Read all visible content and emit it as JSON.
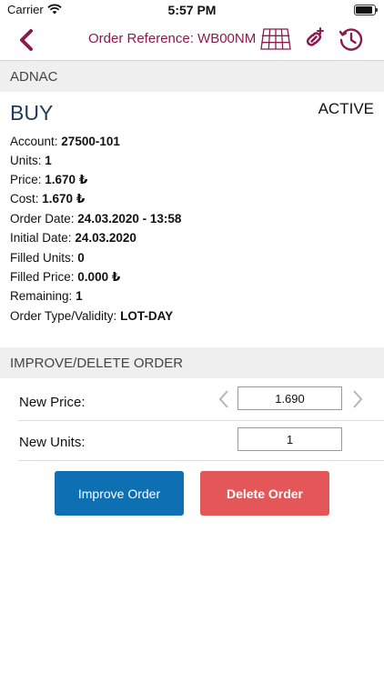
{
  "status_bar": {
    "carrier": "Carrier",
    "time": "5:57 PM"
  },
  "nav": {
    "title": "Order Reference: WB00NM"
  },
  "instrument": {
    "name": "ADNAC"
  },
  "order": {
    "side": "BUY",
    "status": "ACTIVE",
    "details": [
      {
        "label": "Account:",
        "value": "27500-101"
      },
      {
        "label": "Units:",
        "value": "1"
      },
      {
        "label": "Price:",
        "value": "1.670 ₺"
      },
      {
        "label": "Cost:",
        "value": "1.670 ₺"
      },
      {
        "label": "Order Date:",
        "value": "24.03.2020 - 13:58"
      },
      {
        "label": "Initial Date:",
        "value": "24.03.2020"
      },
      {
        "label": "Filled Units:",
        "value": "0"
      },
      {
        "label": "Filled Price:",
        "value": "0.000 ₺"
      },
      {
        "label": "Remaining:",
        "value": "1"
      },
      {
        "label": "Order Type/Validity:",
        "value": "LOT-DAY"
      }
    ]
  },
  "improve_section": {
    "header": "IMPROVE/DELETE ORDER",
    "new_price_label": "New Price:",
    "new_price_value": "1.690",
    "new_units_label": "New Units:",
    "new_units_value": "1",
    "improve_button": "Improve Order",
    "delete_button": "Delete Order"
  },
  "colors": {
    "accent": "#8b1b4e",
    "improve": "#0e6fb3",
    "delete": "#e45759",
    "side": "#1f3b5a"
  },
  "icons": [
    "chevron-left-icon",
    "grid-icon",
    "link-icon",
    "history-icon",
    "wifi-icon",
    "battery-icon"
  ]
}
